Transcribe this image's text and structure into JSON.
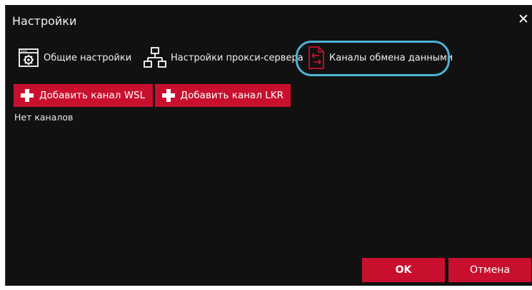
{
  "dialog": {
    "title": "Настройки",
    "close_glyph": "✕"
  },
  "tabs": [
    {
      "label": "Общие настройки",
      "icon": "settings-window-icon"
    },
    {
      "label": "Настройки прокси-сервера",
      "icon": "network-icon"
    },
    {
      "label": "Каналы обмена данными",
      "icon": "data-exchange-icon",
      "highlighted": true
    }
  ],
  "actions": {
    "add_wsl_label": "Добавить канал WSL",
    "add_lkr_label": "Добавить канал LKR"
  },
  "content": {
    "empty_text": "Нет каналов"
  },
  "footer": {
    "ok_label": "OK",
    "cancel_label": "Отмена"
  },
  "colors": {
    "background": "#111111",
    "accent": "#c8102e",
    "highlight": "#4bb6d6"
  }
}
